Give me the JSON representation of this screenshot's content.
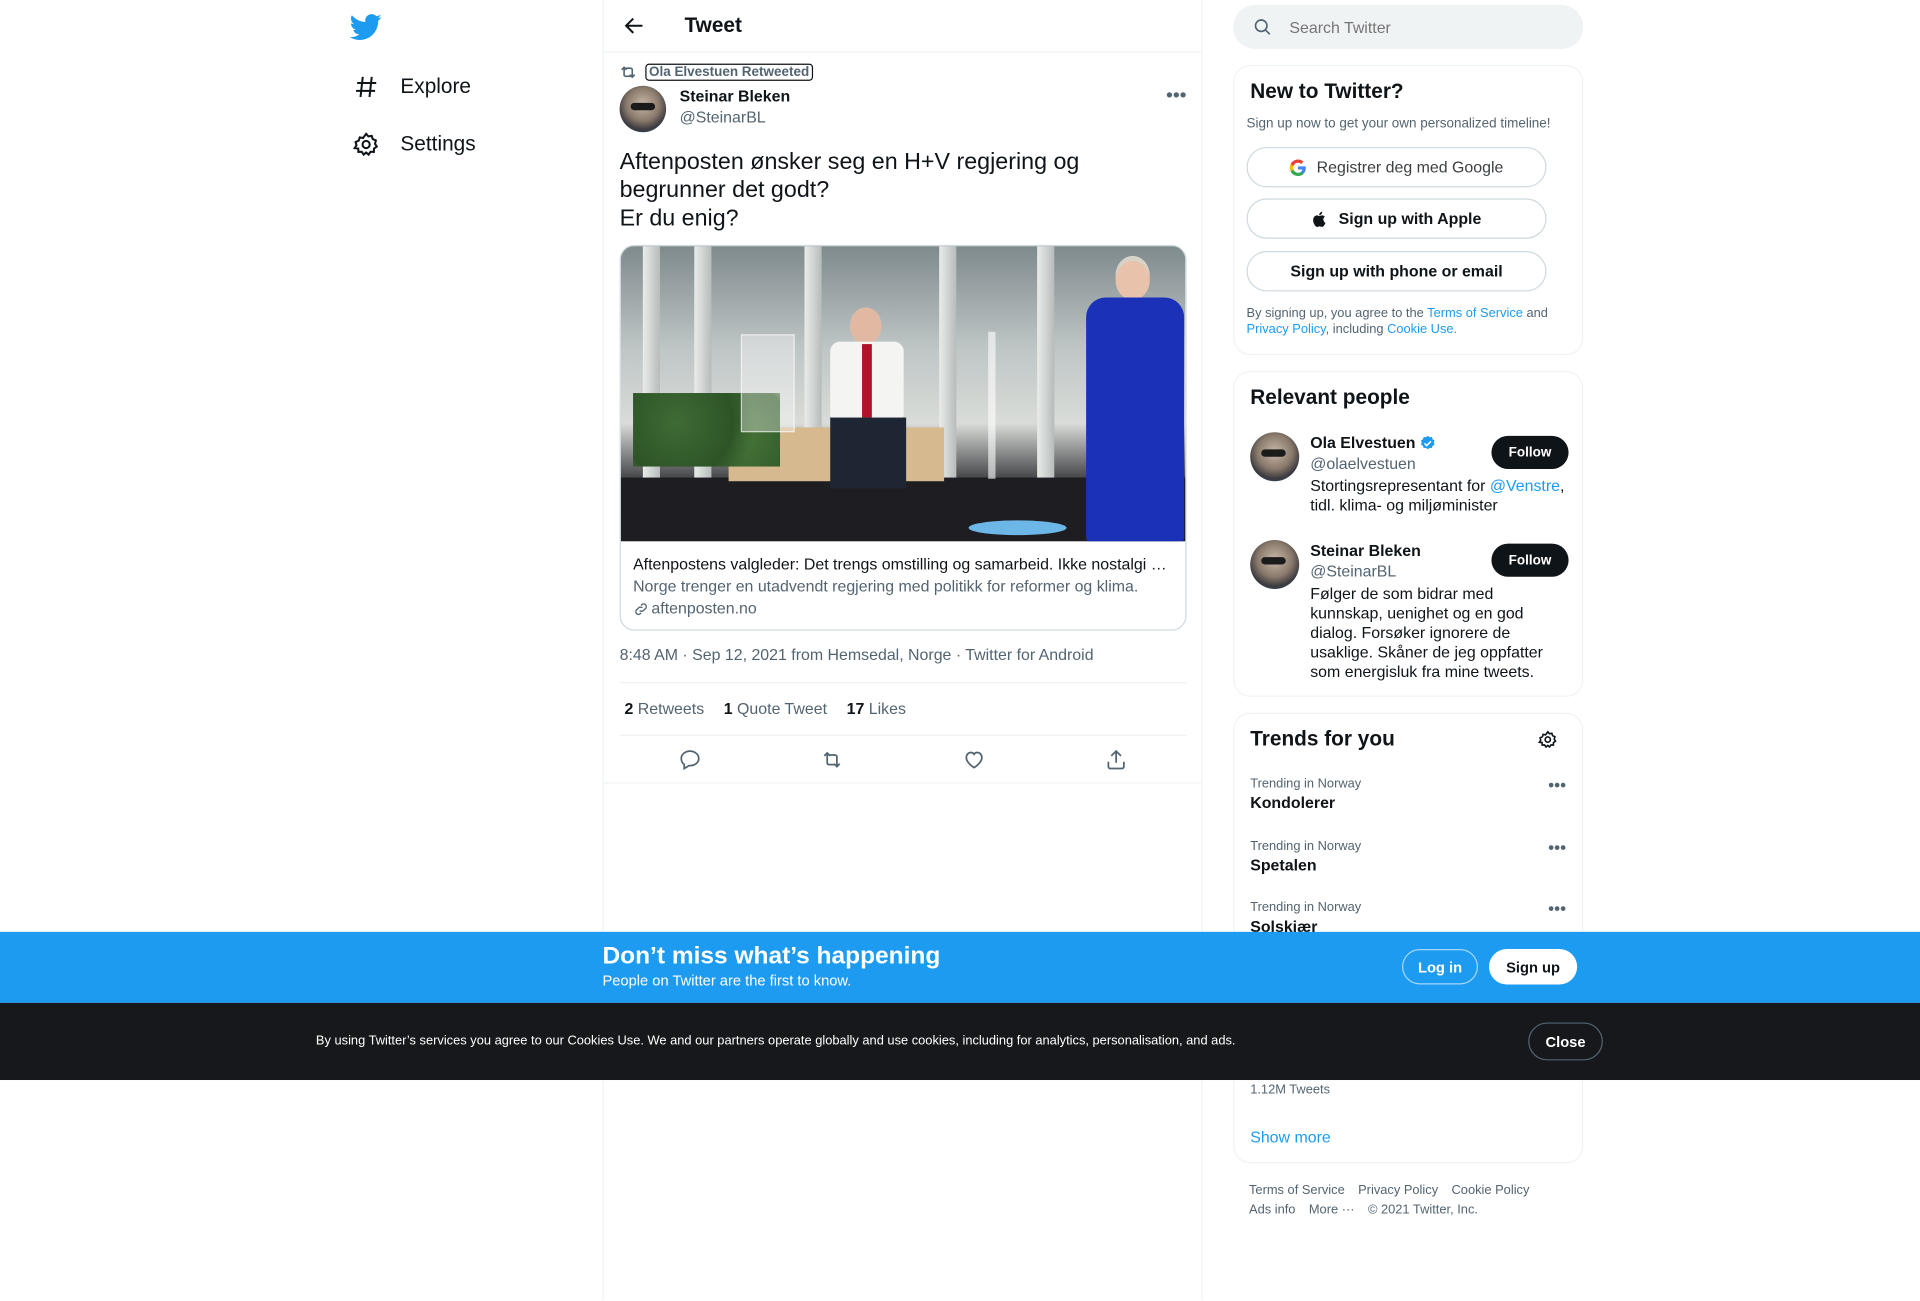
{
  "nav": {
    "explore_label": "Explore",
    "settings_label": "Settings"
  },
  "header": {
    "title": "Tweet"
  },
  "tweet": {
    "retweeted_by": "Ola Elvestuen Retweeted",
    "author_name": "Steinar Bleken",
    "author_handle": "@SteinarBL",
    "text_lines": [
      "Aftenposten ønsker seg en H+V regjering og begrunner det godt?",
      "Er du enig?"
    ],
    "card": {
      "title": "Aftenpostens valgleder: Det trengs omstilling og samarbeid. Ikke nostalgi og re…",
      "description": "Norge trenger en utadvendt regjering med politikk for reformer og klima.",
      "domain": "aftenposten.no"
    },
    "timestamp": "8:48 AM · Sep 12, 2021 from Hemsedal, Norge · Twitter for Android",
    "stats": {
      "retweets_count": "2",
      "retweets_label": "Retweets",
      "quotes_count": "1",
      "quotes_label": "Quote Tweet",
      "likes_count": "17",
      "likes_label": "Likes"
    }
  },
  "search": {
    "placeholder": "Search Twitter"
  },
  "new_to_twitter": {
    "title": "New to Twitter?",
    "subtitle": "Sign up now to get your own personalized timeline!",
    "google_label": "Registrer deg med Google",
    "apple_label": "Sign up with Apple",
    "phone_label": "Sign up with phone or email",
    "legal_prefix": "By signing up, you agree to the ",
    "terms_label": "Terms of Service",
    "legal_and": " and ",
    "privacy_label": "Privacy Policy",
    "legal_including": ", including ",
    "cookie_label": "Cookie Use."
  },
  "relevant_people": {
    "title": "Relevant people",
    "people": [
      {
        "name": "Ola Elvestuen",
        "handle": "@olaelvestuen",
        "bio_prefix": "Stortingsrepresentant for ",
        "bio_mention": "@Venstre",
        "bio_suffix": ", tidl. klima- og miljøminister",
        "follow_label": "Follow",
        "verified": true
      },
      {
        "name": "Steinar Bleken",
        "handle": "@SteinarBL",
        "bio": "Følger de som bidrar med kunnskap, uenighet og en god dialog. Forsøker ignorere de usaklige. Skåner de jeg oppfatter som energisluk fra mine tweets.",
        "follow_label": "Follow"
      }
    ]
  },
  "trends": {
    "title": "Trends for you",
    "items": [
      {
        "context": "Trending in Norway",
        "name": "Kondolerer"
      },
      {
        "context": "Trending in Norway",
        "name": "Spetalen"
      },
      {
        "context": "Trending in Norway",
        "name": "Solskjær"
      }
    ],
    "tweets_count": "1.12M Tweets",
    "show_more": "Show more"
  },
  "footer": {
    "terms": "Terms of Service",
    "privacy": "Privacy Policy",
    "cookie": "Cookie Policy",
    "ads": "Ads info",
    "more": "More ···",
    "copyright": "© 2021 Twitter, Inc."
  },
  "banner": {
    "title": "Don’t miss what’s happening",
    "subtitle": "People on Twitter are the first to know.",
    "login_label": "Log in",
    "signup_label": "Sign up"
  },
  "cookie_banner": {
    "text": "By using Twitter’s services you agree to our Cookies Use. We and our partners operate globally and use cookies, including for analytics, personalisation, and ads.",
    "close_label": "Close"
  },
  "colors": {
    "brand": "#1d9bf0",
    "text": "#0f1419",
    "secondary": "#536471"
  }
}
